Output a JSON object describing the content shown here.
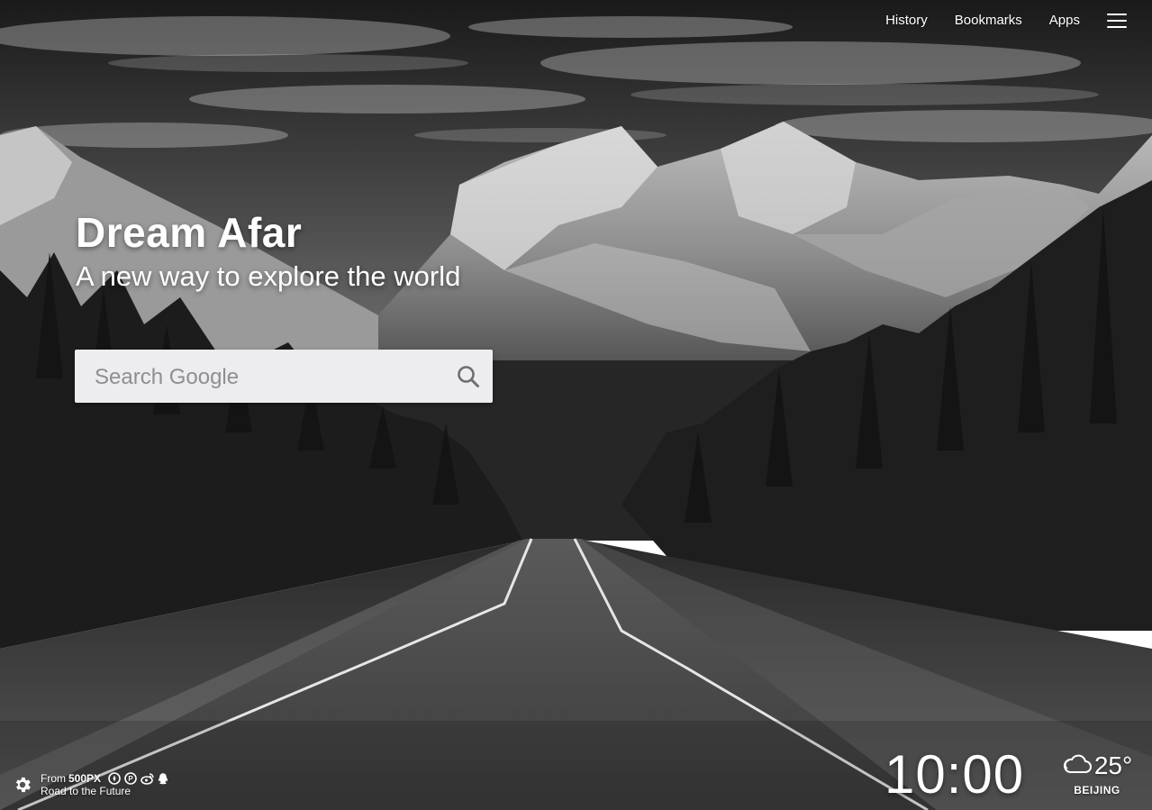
{
  "nav": {
    "history": "History",
    "bookmarks": "Bookmarks",
    "apps": "Apps",
    "menu_icon": "hamburger-menu-icon"
  },
  "hero": {
    "title": "Dream Afar",
    "tagline": "A new way to explore the world"
  },
  "search": {
    "placeholder": "Search Google",
    "value": "",
    "icon": "search-icon"
  },
  "credit": {
    "prefix": "From",
    "source": "500PX",
    "photo_title": "Road to the Future",
    "settings_icon": "gear-icon",
    "social_icons": [
      "compass-icon",
      "pinterest-icon",
      "weibo-icon",
      "qq-icon"
    ]
  },
  "clock": {
    "time": "10:00"
  },
  "weather": {
    "temperature": "25°",
    "city": "BEIJING",
    "icon": "cloud-icon"
  },
  "colors": {
    "text": "#ffffff",
    "search_bg": "#ededef",
    "search_placeholder": "#8e8e93",
    "search_icon": "#6e6e73"
  }
}
